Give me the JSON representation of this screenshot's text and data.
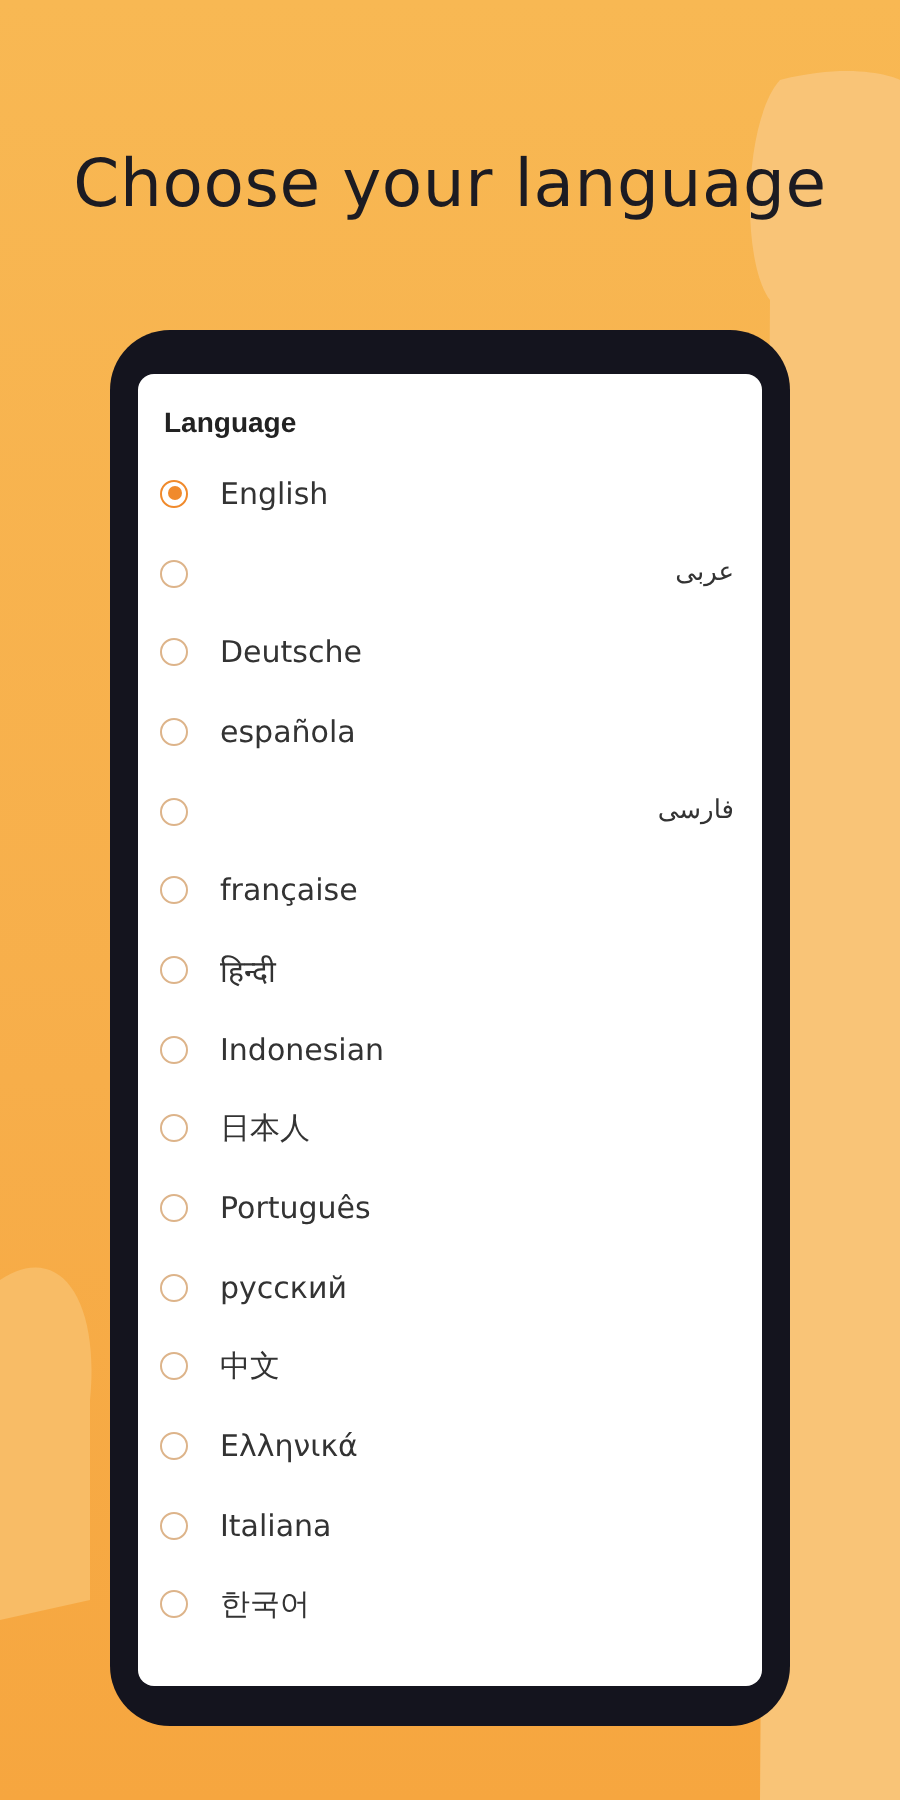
{
  "headline": "Choose your language",
  "dialog": {
    "title": "Language",
    "options": [
      {
        "label": "English",
        "selected": true,
        "kind": "ltr"
      },
      {
        "label": "عربى",
        "selected": false,
        "kind": "rtl"
      },
      {
        "label": "Deutsche",
        "selected": false,
        "kind": "ltr"
      },
      {
        "label": "española",
        "selected": false,
        "kind": "ltr"
      },
      {
        "label": "فارسی",
        "selected": false,
        "kind": "rtl"
      },
      {
        "label": "française",
        "selected": false,
        "kind": "ltr"
      },
      {
        "label": "हिन्दी",
        "selected": false,
        "kind": "ltr"
      },
      {
        "label": "Indonesian",
        "selected": false,
        "kind": "ltr"
      },
      {
        "label": "日本人",
        "selected": false,
        "kind": "ltr"
      },
      {
        "label": "Português",
        "selected": false,
        "kind": "ltr"
      },
      {
        "label": "русский",
        "selected": false,
        "kind": "ltr"
      },
      {
        "label": "中文",
        "selected": false,
        "kind": "ltr"
      },
      {
        "label": "Ελληνικά",
        "selected": false,
        "kind": "ltr"
      },
      {
        "label": "Italiana",
        "selected": false,
        "kind": "ltr"
      },
      {
        "label": "한국어",
        "selected": false,
        "kind": "ltr"
      }
    ]
  }
}
